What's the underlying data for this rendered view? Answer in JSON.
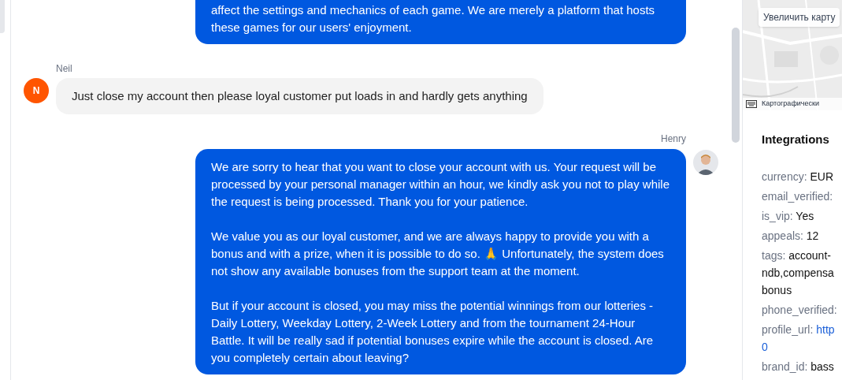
{
  "messages": [
    {
      "kind": "agent",
      "paragraphs": [
        "affect the settings and mechanics of each game. We are merely a platform that hosts these games for our users' enjoyment."
      ],
      "cut_top": true
    },
    {
      "kind": "customer",
      "author": "Neil",
      "initial": "N",
      "paragraphs": [
        "Just close my account then please loyal customer put loads in and hardly gets anything"
      ]
    },
    {
      "kind": "agent",
      "author": "Henry",
      "paragraphs": [
        "We are sorry to hear that you want to close your account with us. Your request will be processed by your personal manager within an hour, we kindly ask you not to play while the request is being processed. Thank you for your patience.",
        "We value you as our loyal customer, and we are always happy to provide you with a bonus and with a prize, when it is possible to do so. 🙏 Unfortunately, the system does not show any available bonuses from the support team at the moment.",
        "But if your account is closed, you may miss the potential winnings from our lotteries - Daily Lottery, Weekday Lottery, 2-Week Lottery and from the tournament 24-Hour Battle. It will be really sad if potential bonuses expire while the account is closed. Are you completely certain about leaving?"
      ]
    }
  ],
  "map": {
    "zoom_button": "Увеличить карту",
    "attribution": "Картографически"
  },
  "integrations": {
    "title": "Integrations",
    "fields": [
      {
        "key": "currency:",
        "value": "EUR",
        "kind": "text"
      },
      {
        "key": "email_verified:",
        "kind": "text"
      },
      {
        "key": "is_vip:",
        "value": "Yes",
        "kind": "text"
      },
      {
        "key": "appeals:",
        "value": "12",
        "kind": "text"
      },
      {
        "key": "tags:",
        "value": "account-",
        "extra": [
          "ndb,compensa",
          "bonus"
        ],
        "kind": "text"
      },
      {
        "key": "phone_verified:",
        "kind": "text"
      },
      {
        "key": "profile_url:",
        "value": "http",
        "extra": [
          "0"
        ],
        "kind": "link"
      },
      {
        "key": "brand_id:",
        "value": "bass",
        "kind": "text"
      }
    ]
  }
}
